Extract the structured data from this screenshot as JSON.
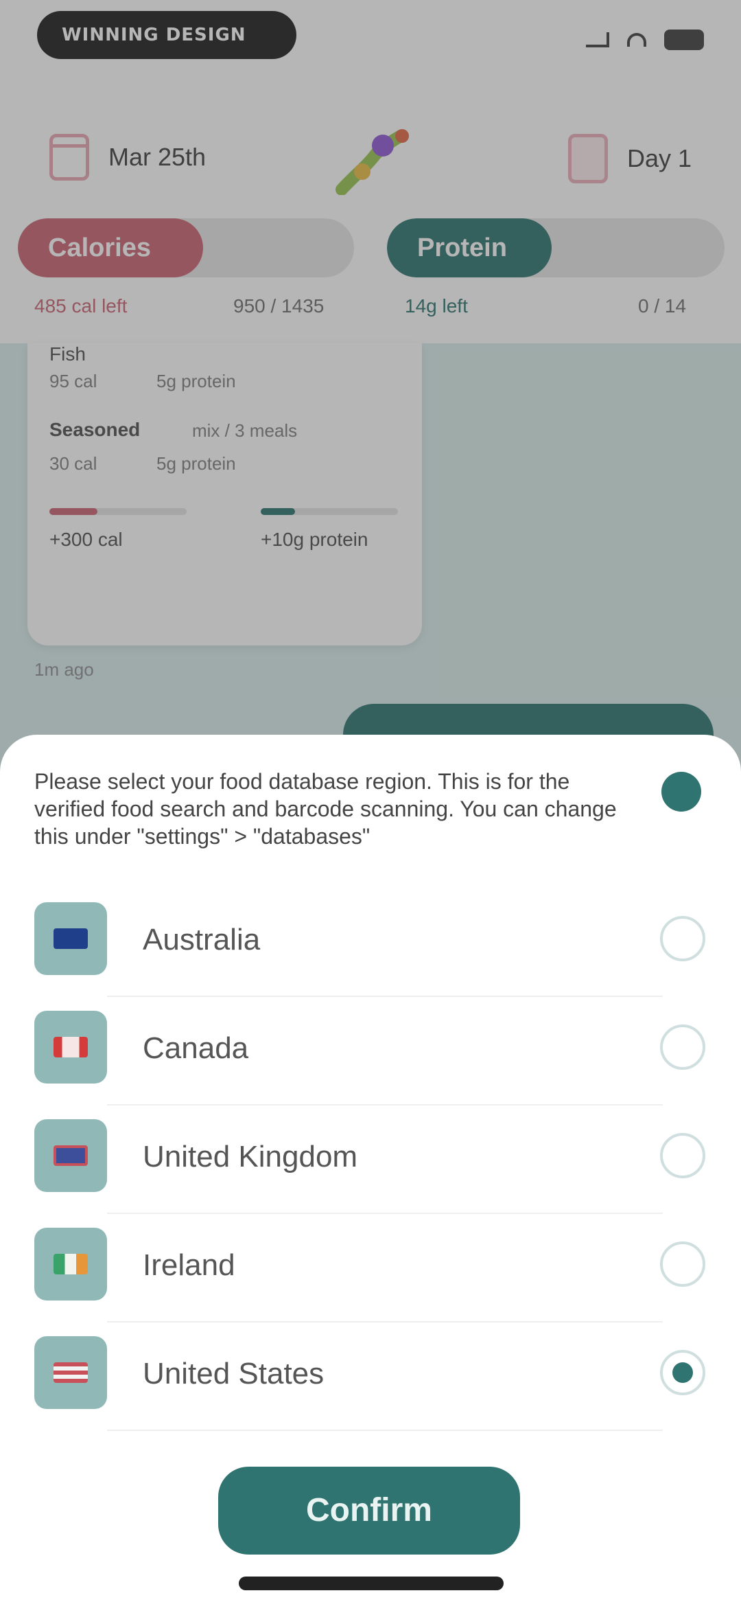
{
  "status_bar": {
    "carrier_text": "WINNING DESIGN"
  },
  "header": {
    "date_label": "Mar 25th",
    "day_label": "Day 1",
    "calories_label": "Calories",
    "protein_label": "Protein",
    "calories_sub_left": "485 cal left",
    "calories_sub_right": "950 / 1435",
    "protein_sub_left": "14g left",
    "protein_sub_right": "0 / 14"
  },
  "chat": {
    "items": [
      {
        "name": "Fish",
        "cal": "95 cal",
        "protein": "5g protein"
      },
      {
        "name": "Seasoned",
        "detail": "mix / 3 meals",
        "cal": "30 cal",
        "protein": "5g protein"
      }
    ],
    "totals": {
      "cal": "+300 cal",
      "protein": "+10g protein"
    },
    "timestamp": "1m ago"
  },
  "sheet": {
    "intro": "Please select your food database region. This is for the verified food search and barcode scanning. You can change this under \"settings\" > \"databases\"",
    "regions": [
      {
        "name": "Australia",
        "selected": false
      },
      {
        "name": "Canada",
        "selected": false
      },
      {
        "name": "United Kingdom",
        "selected": false
      },
      {
        "name": "Ireland",
        "selected": false
      },
      {
        "name": "United States",
        "selected": true
      }
    ],
    "confirm_label": "Confirm"
  },
  "colors": {
    "accent": "#2f7470",
    "calories": "#c95b6b",
    "protein": "#1f6b66"
  }
}
